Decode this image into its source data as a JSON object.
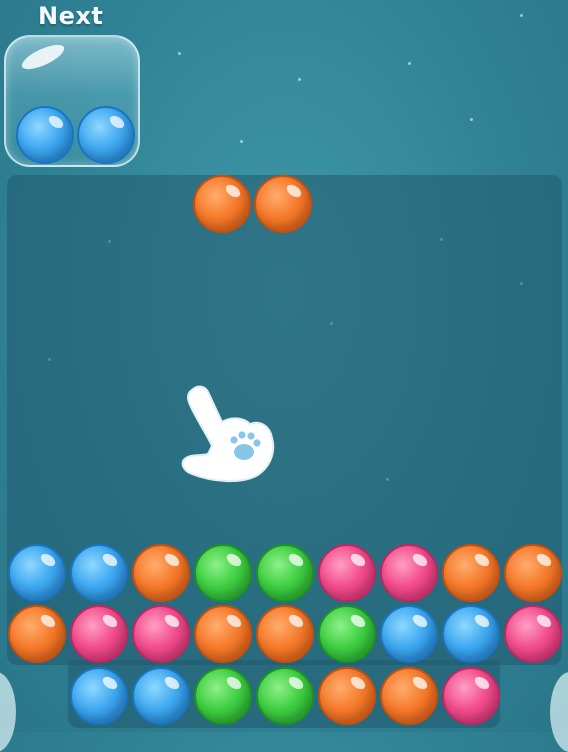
{
  "next_panel": {
    "title": "Next",
    "balls": [
      "blue",
      "blue"
    ]
  },
  "current_pair": [
    "orange",
    "orange"
  ],
  "board": {
    "rows": [
      [
        "blue",
        "blue",
        "orange",
        "green",
        "green",
        "pink",
        "pink",
        "orange",
        "orange"
      ],
      [
        "orange",
        "pink",
        "pink",
        "orange",
        "orange",
        "green",
        "blue",
        "blue",
        "pink"
      ],
      [
        "blue",
        "blue",
        "green",
        "green",
        "orange",
        "orange",
        "pink"
      ]
    ]
  },
  "hint": {
    "icon": "pointing-paw-hand-icon"
  },
  "colors": {
    "blue": "#3ea8f0",
    "orange": "#f57a2b",
    "green": "#3fcf42",
    "pink": "#f24d8c",
    "background": "#2f8294"
  }
}
